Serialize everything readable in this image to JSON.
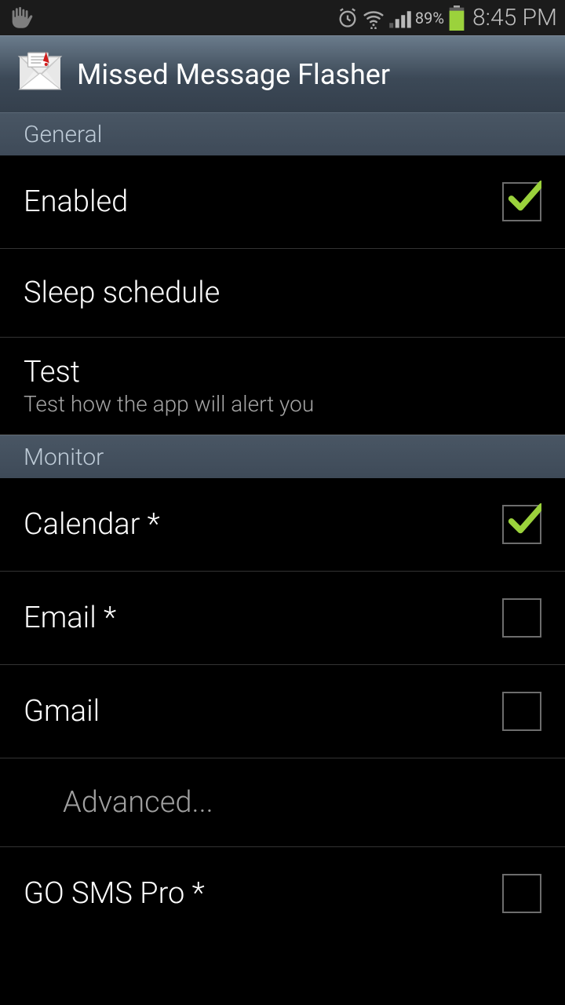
{
  "statusbar": {
    "battery_pct": "89%",
    "clock": "8:45 PM"
  },
  "actionbar": {
    "title": "Missed Message Flasher"
  },
  "section_general": "General",
  "section_monitor": "Monitor",
  "items": {
    "enabled": {
      "title": "Enabled",
      "checked": true
    },
    "sleep": {
      "title": "Sleep schedule"
    },
    "test": {
      "title": "Test",
      "sub": "Test how the app will alert you"
    },
    "calendar": {
      "title": "Calendar *",
      "checked": true
    },
    "email": {
      "title": "Email *",
      "checked": false
    },
    "gmail": {
      "title": "Gmail",
      "checked": false
    },
    "advanced": {
      "title": "Advanced..."
    },
    "gosms": {
      "title": "GO SMS Pro *",
      "checked": false
    }
  }
}
